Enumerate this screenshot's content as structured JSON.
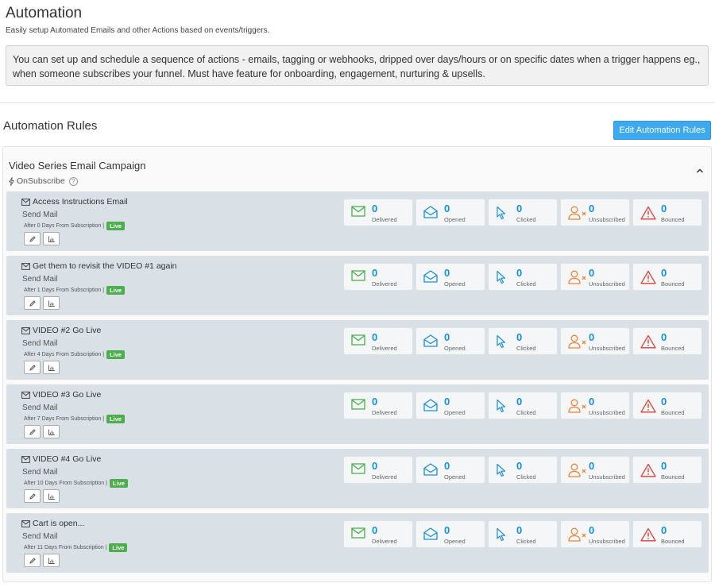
{
  "header": {
    "title": "Automation",
    "subtitle": "Easily setup Automated Emails and other Actions based on events/triggers.",
    "info": "You can set up and schedule a sequence of actions - emails, tagging or webhooks, dripped over days/hours or on specific dates when a trigger happens eg., when someone subscribes your funnel. Must have feature for onboarding, engagement, nurturing & upsells."
  },
  "section": {
    "title": "Automation Rules",
    "edit_label": "Edit Automation Rules"
  },
  "campaign": {
    "title": "Video Series Email Campaign",
    "trigger": "OnSubscribe",
    "help": "?",
    "rules": [
      {
        "title": "Access Instructions Email",
        "action": "Send Mail",
        "schedule": "After 0 Days From Subscription |",
        "status": "Live",
        "stats": {
          "delivered": "0",
          "opened": "0",
          "clicked": "0",
          "unsubscribed": "0",
          "bounced": "0"
        }
      },
      {
        "title": "Get them to revisit the VIDEO #1 again",
        "action": "Send Mail",
        "schedule": "After 1 Days From Subscription |",
        "status": "Live",
        "stats": {
          "delivered": "0",
          "opened": "0",
          "clicked": "0",
          "unsubscribed": "0",
          "bounced": "0"
        }
      },
      {
        "title": "VIDEO #2 Go Live",
        "action": "Send Mail",
        "schedule": "After 4 Days From Subscription |",
        "status": "Live",
        "stats": {
          "delivered": "0",
          "opened": "0",
          "clicked": "0",
          "unsubscribed": "0",
          "bounced": "0"
        }
      },
      {
        "title": "VIDEO #3 Go Live",
        "action": "Send Mail",
        "schedule": "After 7 Days From Subscription |",
        "status": "Live",
        "stats": {
          "delivered": "0",
          "opened": "0",
          "clicked": "0",
          "unsubscribed": "0",
          "bounced": "0"
        }
      },
      {
        "title": "VIDEO #4 Go Live",
        "action": "Send Mail",
        "schedule": "After 10 Days From Subscription |",
        "status": "Live",
        "stats": {
          "delivered": "0",
          "opened": "0",
          "clicked": "0",
          "unsubscribed": "0",
          "bounced": "0"
        }
      },
      {
        "title": "Cart is open...",
        "action": "Send Mail",
        "schedule": "After 11 Days From Subscription |",
        "status": "Live",
        "stats": {
          "delivered": "0",
          "opened": "0",
          "clicked": "0",
          "unsubscribed": "0",
          "bounced": "0"
        }
      }
    ]
  },
  "stat_labels": {
    "delivered": "Delivered",
    "opened": "Opened",
    "clicked": "Clicked",
    "unsubscribed": "Unsubscribed",
    "bounced": "Bounced"
  },
  "colors": {
    "accent": "#3ca9f0",
    "live": "#4cae4c",
    "stat_number": "#1a8fd6",
    "delivered_icon": "#4cae4c",
    "opened_icon": "#1a8fd6",
    "clicked_icon": "#1a8fd6",
    "unsubscribed_icon": "#e8873a",
    "bounced_icon": "#d9433b",
    "rule_bg": "#d9e1e6"
  },
  "icons": {
    "trigger": "lightning-icon",
    "rule": "envelope-icon",
    "edit": "pencil-icon",
    "report": "bar-chart-icon",
    "collapse": "chevron-up-icon",
    "delivered": "envelope-icon",
    "opened": "envelope-open-icon",
    "clicked": "cursor-icon",
    "unsubscribed": "user-remove-icon",
    "bounced": "warning-icon"
  }
}
